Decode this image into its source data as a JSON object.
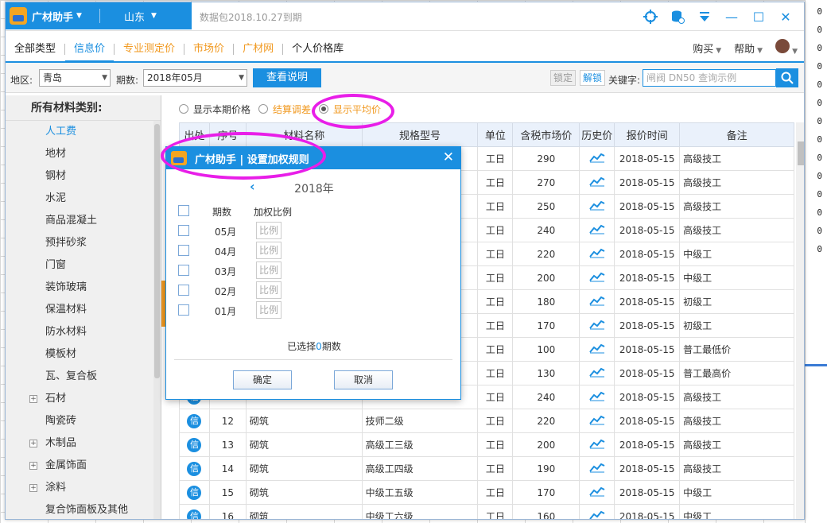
{
  "app": {
    "name": "广材助手",
    "province": "山东",
    "expiry_notice": "数据包2018.10.27到期"
  },
  "tabs": [
    {
      "label": "全部类型",
      "style": "normal"
    },
    {
      "label": "信息价",
      "style": "active"
    },
    {
      "label": "专业测定价",
      "style": "orange"
    },
    {
      "label": "市场价",
      "style": "orange"
    },
    {
      "label": "广材网",
      "style": "orange"
    },
    {
      "label": "个人价格库",
      "style": "normal"
    }
  ],
  "menu_right": {
    "buy": "购买",
    "help": "帮助"
  },
  "filter": {
    "region_label": "地区:",
    "region_value": "青岛",
    "period_label": "期数:",
    "period_value": "2018年05月",
    "view_button": "查看说明",
    "lock_label": "锁定",
    "unlock_label": "解锁",
    "keyword_label": "关键字:",
    "search_placeholder": "闸阀 DN50 查询示例"
  },
  "sidebar": {
    "header": "所有材料类别:",
    "items": [
      {
        "label": "人工费",
        "expandable": false
      },
      {
        "label": "地材",
        "expandable": false
      },
      {
        "label": "钢材",
        "expandable": false
      },
      {
        "label": "水泥",
        "expandable": false
      },
      {
        "label": "商品混凝土",
        "expandable": false
      },
      {
        "label": "预拌砂浆",
        "expandable": false
      },
      {
        "label": "门窗",
        "expandable": false
      },
      {
        "label": "装饰玻璃",
        "expandable": false
      },
      {
        "label": "保温材料",
        "expandable": false
      },
      {
        "label": "防水材料",
        "expandable": false
      },
      {
        "label": "模板材",
        "expandable": false
      },
      {
        "label": "瓦、复合板",
        "expandable": false
      },
      {
        "label": "石材",
        "expandable": true
      },
      {
        "label": "陶瓷砖",
        "expandable": false
      },
      {
        "label": "木制品",
        "expandable": true
      },
      {
        "label": "金属饰面",
        "expandable": true
      },
      {
        "label": "涂料",
        "expandable": true
      },
      {
        "label": "复合饰面板及其他",
        "expandable": false
      }
    ]
  },
  "radios": [
    {
      "label": "显示本期价格",
      "checked": false
    },
    {
      "label": "结算调差",
      "checked": false
    },
    {
      "label": "显示平均价",
      "checked": true
    }
  ],
  "table": {
    "columns": [
      "出处",
      "序号",
      "材料名称",
      "规格型号",
      "单位",
      "含税市场价",
      "历史价",
      "报价时间",
      "备注"
    ],
    "rows": [
      {
        "seq": "",
        "name": "",
        "spec": "",
        "unit": "工日",
        "price": "290",
        "date": "2018-05-15",
        "note": "高级技工"
      },
      {
        "seq": "",
        "name": "",
        "spec": "",
        "unit": "工日",
        "price": "270",
        "date": "2018-05-15",
        "note": "高级技工"
      },
      {
        "seq": "",
        "name": "",
        "spec": "",
        "unit": "工日",
        "price": "250",
        "date": "2018-05-15",
        "note": "高级技工"
      },
      {
        "seq": "",
        "name": "",
        "spec": "",
        "unit": "工日",
        "price": "240",
        "date": "2018-05-15",
        "note": "高级技工"
      },
      {
        "seq": "",
        "name": "",
        "spec": "",
        "unit": "工日",
        "price": "220",
        "date": "2018-05-15",
        "note": "中级工"
      },
      {
        "seq": "",
        "name": "",
        "spec": "",
        "unit": "工日",
        "price": "200",
        "date": "2018-05-15",
        "note": "中级工"
      },
      {
        "seq": "",
        "name": "",
        "spec": "",
        "unit": "工日",
        "price": "180",
        "date": "2018-05-15",
        "note": "初级工"
      },
      {
        "seq": "",
        "name": "",
        "spec": "",
        "unit": "工日",
        "price": "170",
        "date": "2018-05-15",
        "note": "初级工"
      },
      {
        "seq": "",
        "name": "",
        "spec": "",
        "unit": "工日",
        "price": "100",
        "date": "2018-05-15",
        "note": "普工最低价"
      },
      {
        "seq": "",
        "name": "",
        "spec": "",
        "unit": "工日",
        "price": "130",
        "date": "2018-05-15",
        "note": "普工最高价"
      },
      {
        "seq": "",
        "name": "",
        "spec": "",
        "unit": "工日",
        "price": "240",
        "date": "2018-05-15",
        "note": "高级技工"
      },
      {
        "seq": "12",
        "name": "砌筑",
        "spec": "技师二级",
        "unit": "工日",
        "price": "220",
        "date": "2018-05-15",
        "note": "高级技工"
      },
      {
        "seq": "13",
        "name": "砌筑",
        "spec": "高级工三级",
        "unit": "工日",
        "price": "200",
        "date": "2018-05-15",
        "note": "高级技工"
      },
      {
        "seq": "14",
        "name": "砌筑",
        "spec": "高级工四级",
        "unit": "工日",
        "price": "190",
        "date": "2018-05-15",
        "note": "高级技工"
      },
      {
        "seq": "15",
        "name": "砌筑",
        "spec": "中级工五级",
        "unit": "工日",
        "price": "170",
        "date": "2018-05-15",
        "note": "中级工"
      },
      {
        "seq": "16",
        "name": "砌筑",
        "spec": "中级工六级",
        "unit": "工日",
        "price": "160",
        "date": "2018-05-15",
        "note": "中级工"
      }
    ],
    "source_badge": "信"
  },
  "dialog": {
    "title": "广材助手 | 设置加权规则",
    "year": "2018年",
    "col_period": "期数",
    "col_weight": "加权比例",
    "months": [
      "05月",
      "04月",
      "03月",
      "02月",
      "01月"
    ],
    "ratio_placeholder": "比例",
    "summary_prefix": "已选择",
    "summary_count": "0",
    "summary_suffix": "期数",
    "ok": "确定",
    "cancel": "取消"
  },
  "background_numbers": [
    "0",
    "0",
    "0",
    "0",
    "0",
    "0",
    "0",
    "0",
    "0",
    "0",
    "0",
    "0",
    "0",
    "0"
  ]
}
